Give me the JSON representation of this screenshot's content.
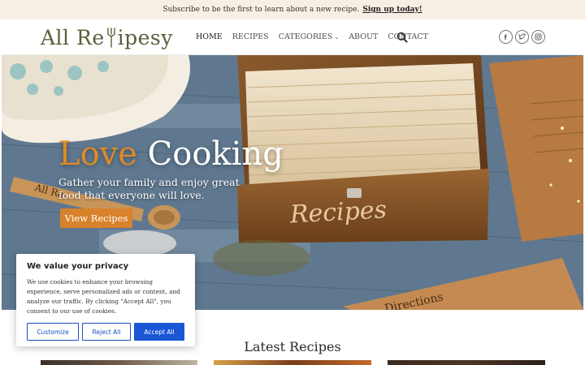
{
  "announcement": {
    "text": "Subscribe to be the first to learn about a new recipe.",
    "cta": "Sign up today!"
  },
  "header": {
    "logo_text_left": "All Re",
    "logo_text_right": "ipesy",
    "nav": [
      {
        "label": "HOME"
      },
      {
        "label": "RECIPES"
      },
      {
        "label": "CATEGORIES",
        "has_dropdown": true
      },
      {
        "label": "ABOUT"
      },
      {
        "label": "CONTACT"
      }
    ],
    "search_icon": "search-icon",
    "socials": [
      "facebook-icon",
      "twitter-icon",
      "instagram-icon"
    ]
  },
  "hero": {
    "title_accent": "Love",
    "title_main": "Cooking",
    "subtitle": "Gather your family and enjoy great food that everyone will love.",
    "button": "View Recipes",
    "accent_color": "#e08a23",
    "box_label": "Recipes",
    "card_label": "Directions",
    "spoon_label": "All Re"
  },
  "latest": {
    "heading": "Latest Recipes"
  },
  "cookie": {
    "title": "We value your privacy",
    "text": "We use cookies to enhance your browsing experience, serve personalized ads or content, and analyze our traffic. By clicking \"Accept All\", you consent to our use of cookies.",
    "customize": "Customize",
    "reject": "Reject All",
    "accept": "Accept All",
    "accent_color": "#1b56d6"
  }
}
